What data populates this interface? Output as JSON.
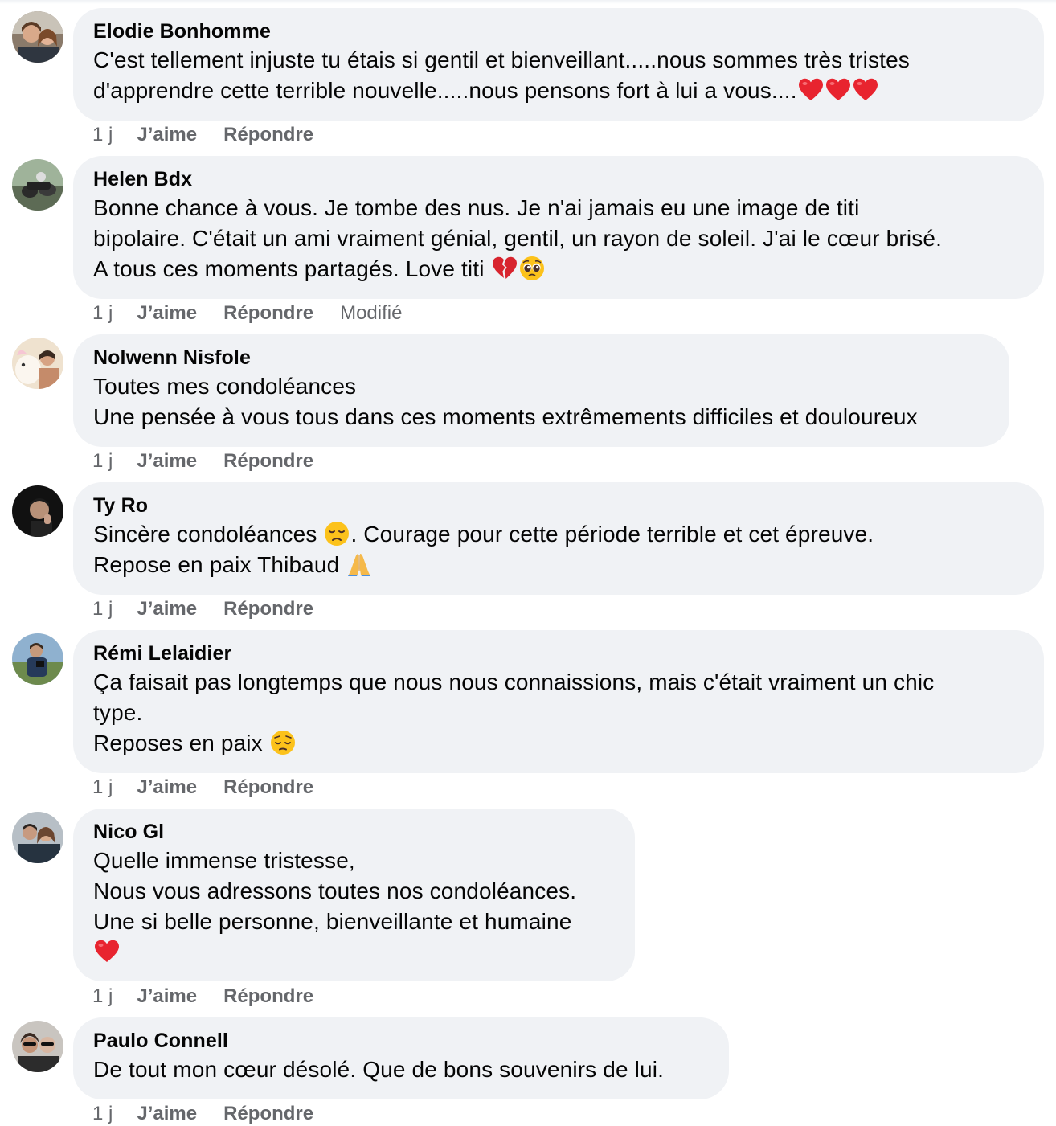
{
  "actions": {
    "like_label": "J’aime",
    "reply_label": "Répondre",
    "edited_label": "Modifié"
  },
  "colors": {
    "bubble": "#f0f2f5",
    "meta_text": "#65676b",
    "body_text": "#050505",
    "heart": "#e8242f"
  },
  "comments": [
    {
      "author": "Elodie Bonhomme",
      "lines": [
        "C'est tellement injuste tu étais si gentil et bienveillant.....nous sommes très tristes",
        "d'apprendre cette terrible nouvelle.....nous pensons fort à lui a vous...."
      ],
      "emojis": [
        "red-heart",
        "red-heart",
        "red-heart"
      ],
      "time": "1 j",
      "edited": false
    },
    {
      "author": "Helen Bdx",
      "lines": [
        "Bonne chance à vous. Je tombe des nus. Je n'ai jamais eu une image de titi",
        "bipolaire. C'était un ami vraiment génial, gentil, un rayon de soleil. J'ai le cœur brisé.",
        "A tous ces moments partagés. Love titi "
      ],
      "emojis": [
        "broken-heart",
        "pleading-face"
      ],
      "time": "1 j",
      "edited": true
    },
    {
      "author": "Nolwenn Nisfole",
      "lines": [
        "Toutes mes condoléances",
        "Une pensée à vous tous dans ces moments extrêmements difficiles et douloureux"
      ],
      "time": "1 j",
      "edited": false
    },
    {
      "author": "Ty Ro",
      "line1_before": "Sincère condoléances ",
      "line1_after": ". Courage pour cette période terrible et cet épreuve.",
      "line2": "Repose en paix Thibaud ",
      "emojis": [
        "disappointed-face",
        "folded-hands"
      ],
      "time": "1 j",
      "edited": false
    },
    {
      "author": "Rémi Lelaidier",
      "lines": [
        "Ça faisait pas longtemps que nous nous connaissions, mais c'était vraiment un chic",
        "type.",
        "Reposes en paix "
      ],
      "emojis": [
        "pensive-face"
      ],
      "time": "1 j",
      "edited": false
    },
    {
      "author": "Nico Gl",
      "lines": [
        "Quelle immense tristesse,",
        "Nous vous adressons toutes nos condoléances.",
        "Une si belle personne, bienveillante et humaine"
      ],
      "emojis": [
        "red-heart"
      ],
      "time": "1 j",
      "edited": false
    },
    {
      "author": "Paulo Connell",
      "lines": [
        "De tout mon cœur désolé. Que de bons souvenirs de lui."
      ],
      "time": "1 j",
      "edited": false
    }
  ]
}
